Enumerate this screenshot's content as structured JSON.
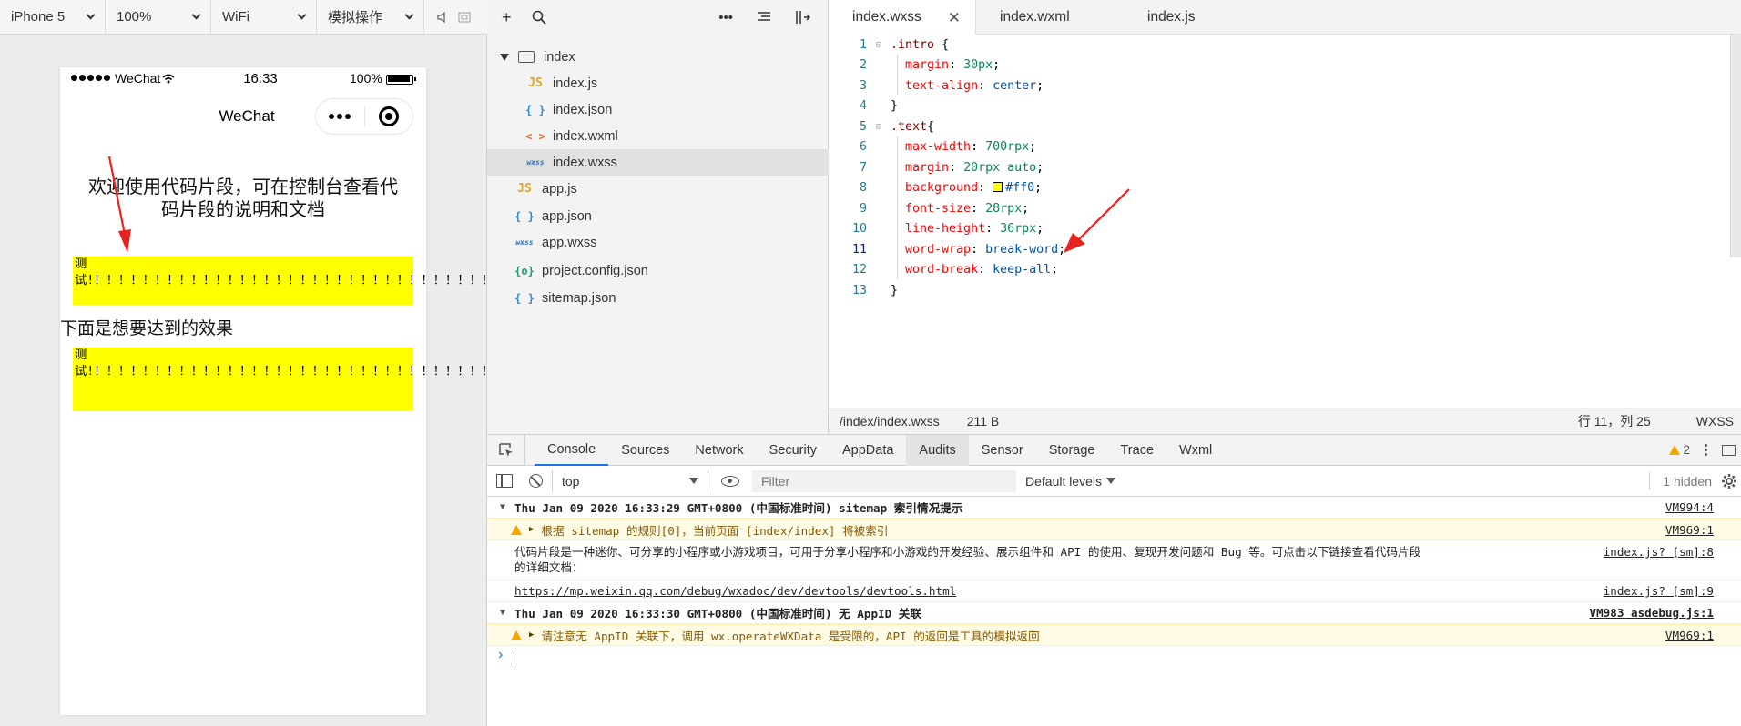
{
  "simulator_toolbar": {
    "device": "iPhone 5",
    "zoom": "100%",
    "network": "WiFi",
    "operation": "模拟操作"
  },
  "phone": {
    "status_bar": {
      "carrier": "WeChat",
      "time": "16:33",
      "battery": "100%"
    },
    "nav_title": "WeChat",
    "intro_text": "欢迎使用代码片段，可在控制台查看代码片段的说明和文档",
    "box1_text": "测试!！！！！！！！！！！！！！！！！！！！！！！！！！！！！！！！！！！！！！！！！！！！！！！！！！！！！！！！！！！！！！！！！！！！！！！",
    "subtitle": "下面是想要达到的效果",
    "box2_text": "测试!！！！！！！！！！！！！！！！！！！！！！！！！！！！！！！！！！！！！！！！！！！！！！！！！！！！！！！！！！！！！！！！！！！！！！！！！！！！！！！！！！！！！！"
  },
  "file_tree": {
    "folder": "index",
    "children": [
      {
        "name": "index.js",
        "icon": "JS"
      },
      {
        "name": "index.json",
        "icon": "{ }"
      },
      {
        "name": "index.wxml",
        "icon": "< >"
      },
      {
        "name": "index.wxss",
        "icon": "wxss"
      }
    ],
    "root_files": [
      {
        "name": "app.js",
        "icon": "JS"
      },
      {
        "name": "app.json",
        "icon": "{ }"
      },
      {
        "name": "app.wxss",
        "icon": "wxss"
      },
      {
        "name": "project.config.json",
        "icon": "{o}"
      },
      {
        "name": "sitemap.json",
        "icon": "{ }"
      }
    ]
  },
  "editor": {
    "tabs": [
      "index.wxss",
      "index.wxml",
      "index.js"
    ],
    "lines": [
      {
        "n": "1",
        "sel": ".intro",
        "rest": " {"
      },
      {
        "n": "2",
        "prop": "margin",
        "val": "30px"
      },
      {
        "n": "3",
        "prop": "text-align",
        "val": "center"
      },
      {
        "n": "4",
        "close": "}"
      },
      {
        "n": "5",
        "sel": ".text",
        "rest": "{"
      },
      {
        "n": "6",
        "prop": "max-width",
        "val": "700rpx"
      },
      {
        "n": "7",
        "prop": "margin",
        "val": "20rpx auto"
      },
      {
        "n": "8",
        "prop": "background",
        "val": "#ff0"
      },
      {
        "n": "9",
        "prop": "font-size",
        "val": "28rpx"
      },
      {
        "n": "10",
        "prop": "line-height",
        "val": "36rpx"
      },
      {
        "n": "11",
        "prop": "word-wrap",
        "val": "break-word"
      },
      {
        "n": "12",
        "prop": "word-break",
        "val": "keep-all"
      },
      {
        "n": "13",
        "close": "}"
      }
    ],
    "status": {
      "path": "/index/index.wxss",
      "size": "211 B",
      "position": "行 11，列 25",
      "language": "WXSS"
    }
  },
  "devtools": {
    "tabs": [
      "Console",
      "Sources",
      "Network",
      "Security",
      "AppData",
      "Audits",
      "Sensor",
      "Storage",
      "Trace",
      "Wxml"
    ],
    "warning_count": "2",
    "context": "top",
    "filter_placeholder": "Filter",
    "levels": "Default levels",
    "hidden": "1 hidden",
    "messages": {
      "g1_title": "Thu Jan 09 2020 16:33:29 GMT+0800 (中国标准时间) sitemap 索引情况提示",
      "g1_src": "VM994:4",
      "w1_text": "根据 sitemap 的规则[0]，当前页面 [index/index] 将被索引",
      "w1_src": "VM969:1",
      "log1_line1": "代码片段是一种迷你、可分享的小程序或小游戏项目，可用于分享小程序和小游戏的开发经验、展示组件和 API 的使用、复现开发问题和 Bug 等。可点击以下链接查看代码片段",
      "log1_line2": "的详细文档：",
      "log1_src": "index.js? [sm]:8",
      "log2_link": "https://mp.weixin.qq.com/debug/wxadoc/dev/devtools/devtools.html",
      "log2_src": "index.js? [sm]:9",
      "g2_title": "Thu Jan 09 2020 16:33:30 GMT+0800 (中国标准时间) 无 AppID 关联",
      "g2_src": "VM983 asdebug.js:1",
      "w2_text": "请注意无 AppID 关联下，调用 wx.operateWXData 是受限的，API 的返回是工具的模拟返回",
      "w2_src": "VM969:1"
    }
  },
  "colors": {
    "highlight_yellow": "#ffff00",
    "accent_blue": "#1a73e8",
    "warning": "#f2a600",
    "arrow_red": "#e8231f"
  }
}
